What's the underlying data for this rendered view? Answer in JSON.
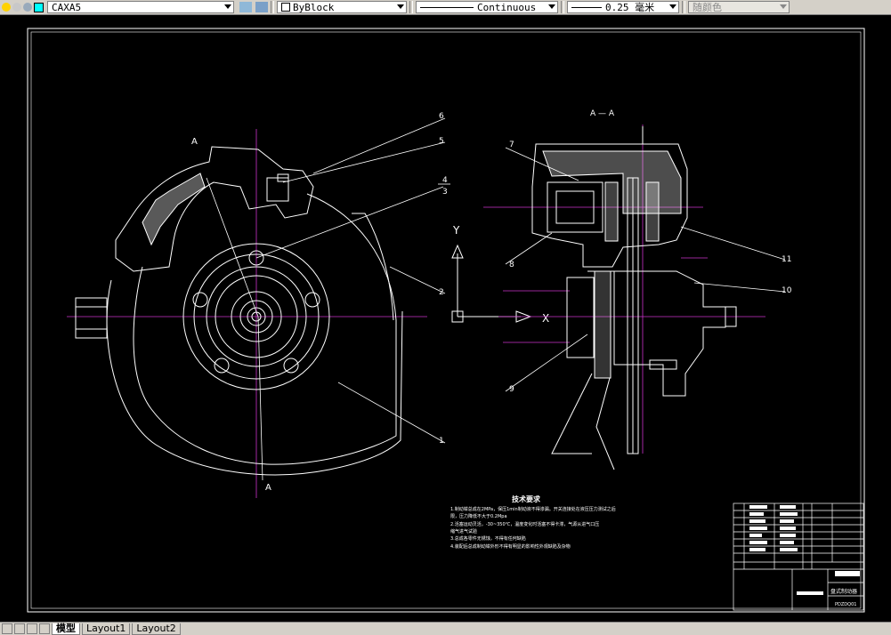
{
  "toolbar": {
    "layer_name": "CAXA5",
    "color_value": "ByBlock",
    "linetype_value": "Continuous",
    "lineweight_value": "0.25 毫米",
    "plotstyle_value": "随颜色"
  },
  "drawing": {
    "section_label_a1": "A",
    "section_label_a2": "A",
    "section_title": "A — A",
    "axis_y": "Y",
    "axis_x": "X",
    "callouts": [
      "1",
      "2",
      "3",
      "4",
      "5",
      "6",
      "7",
      "8",
      "9",
      "10",
      "11"
    ],
    "tech_req_title": "技术要求",
    "tech_req_lines": [
      "1.制动钳总成在2MPa，保压1min制动液不得渗漏。开关连接处在液压压力测试之后",
      "限，压力降低不大于0.2Mpa",
      "2.活塞运动灵活，-30~350℃，温度变化时活塞不得卡滞，气源从进气口压",
      "缩气进气试验",
      "3.总成各零件无锈蚀，不得有任何缺陷",
      "4.装配后总成制动钳外形不得有明显的影响性外观缺陷及杂物"
    ],
    "title_block_name": "盘式制动器",
    "title_block_code": "PDZDQ01"
  },
  "tabs": [
    "模型",
    "Layout1",
    "Layout2"
  ],
  "colors": {
    "line": "#ffffff",
    "centerline": "#cc33cc",
    "background": "#000000"
  }
}
